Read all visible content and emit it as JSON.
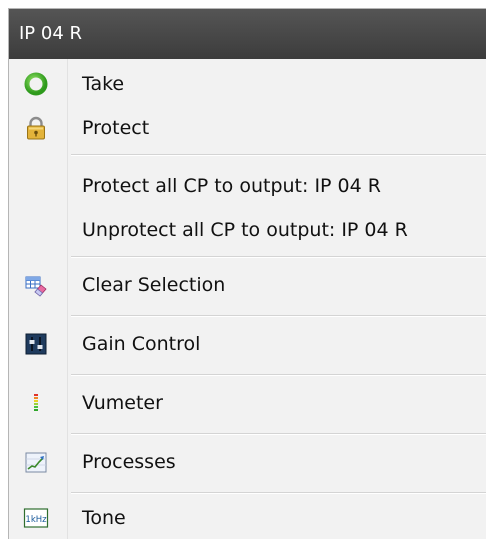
{
  "menu": {
    "title": "IP 04 R",
    "items": [
      {
        "label": "Take",
        "icon": "green-circle-icon"
      },
      {
        "label": "Protect",
        "icon": "padlock-icon"
      },
      {
        "label": "Protect all CP to output: IP 04 R"
      },
      {
        "label": "Unprotect all CP to output: IP 04 R"
      },
      {
        "label": "Clear Selection",
        "icon": "eraser-grid-icon"
      },
      {
        "label": "Gain Control",
        "icon": "fader-icon"
      },
      {
        "label": "Vumeter",
        "icon": "vu-meter-icon"
      },
      {
        "label": "Processes",
        "icon": "graph-icon"
      },
      {
        "label": "Tone",
        "icon": "tone-1khz-icon",
        "icon_text": "1kHz"
      }
    ]
  }
}
